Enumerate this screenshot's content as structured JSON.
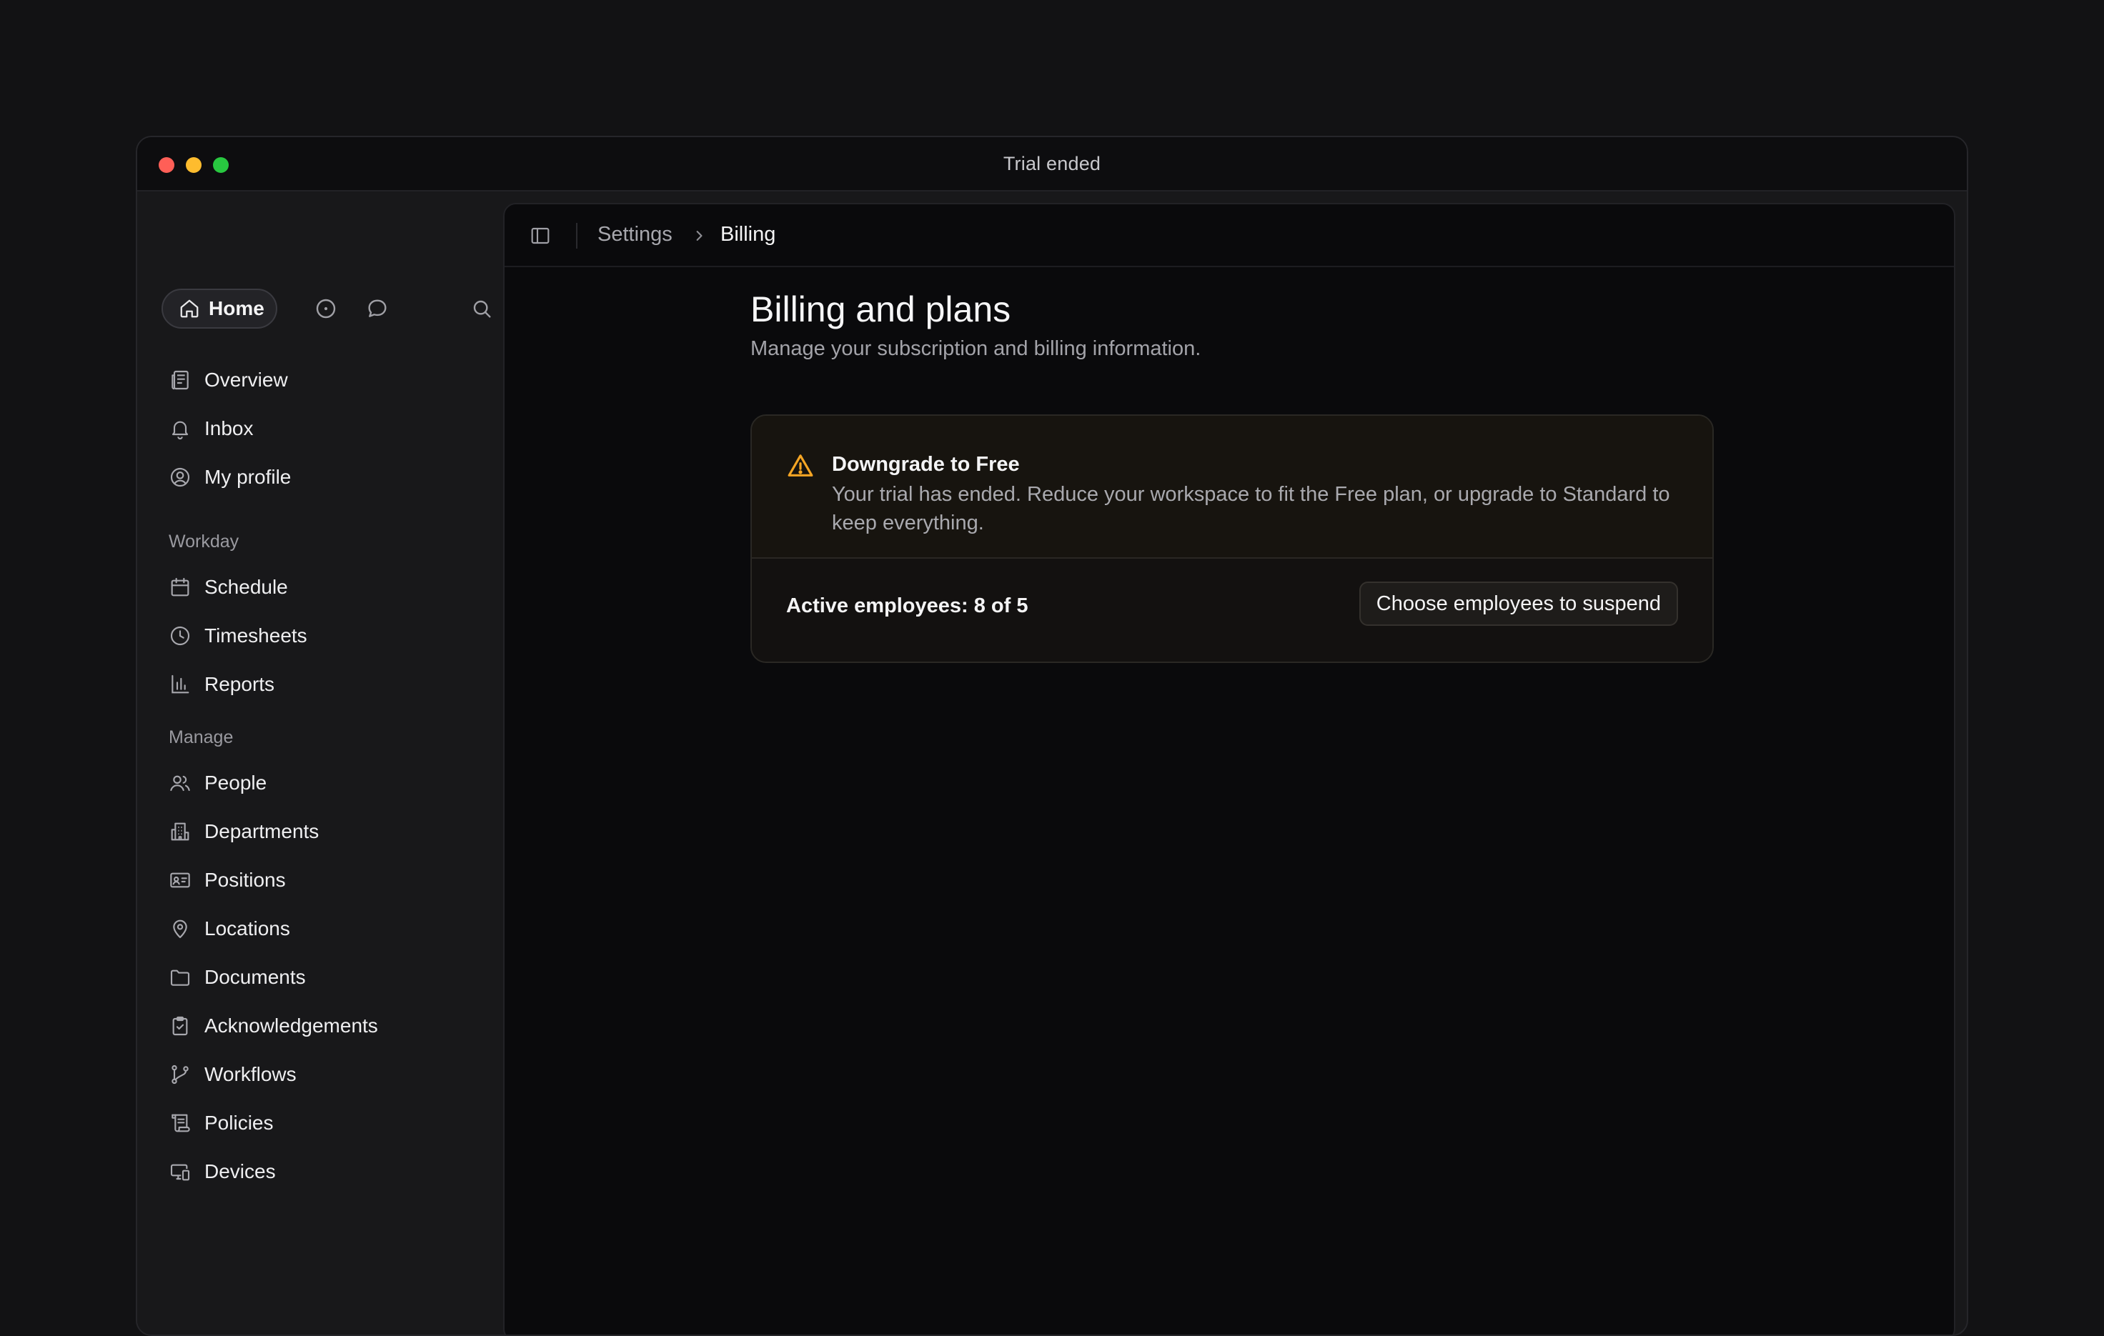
{
  "window": {
    "title": "Trial ended"
  },
  "quickbar": {
    "home_label": "Home"
  },
  "sidebar": {
    "primary": [
      {
        "label": "Overview",
        "icon": "overview-icon"
      },
      {
        "label": "Inbox",
        "icon": "bell-icon"
      },
      {
        "label": "My profile",
        "icon": "user-circle-icon"
      }
    ],
    "workday_label": "Workday",
    "workday": [
      {
        "label": "Schedule",
        "icon": "calendar-icon"
      },
      {
        "label": "Timesheets",
        "icon": "clock-icon"
      },
      {
        "label": "Reports",
        "icon": "bar-chart-icon"
      }
    ],
    "manage_label": "Manage",
    "manage": [
      {
        "label": "People",
        "icon": "people-icon"
      },
      {
        "label": "Departments",
        "icon": "building-icon"
      },
      {
        "label": "Positions",
        "icon": "id-card-icon"
      },
      {
        "label": "Locations",
        "icon": "map-pin-icon"
      },
      {
        "label": "Documents",
        "icon": "folder-icon"
      },
      {
        "label": "Acknowledgements",
        "icon": "clipboard-check-icon"
      },
      {
        "label": "Workflows",
        "icon": "git-branch-icon"
      },
      {
        "label": "Policies",
        "icon": "scroll-icon"
      },
      {
        "label": "Devices",
        "icon": "devices-icon"
      }
    ]
  },
  "breadcrumb": {
    "parent": "Settings",
    "current": "Billing"
  },
  "page": {
    "title": "Billing and plans",
    "subtitle": "Manage your subscription and billing information."
  },
  "alert": {
    "title": "Downgrade to Free",
    "body": "Your trial has ended. Reduce your workspace to fit the Free plan, or upgrade to Standard to keep everything.",
    "active_employees": "Active employees: 8 of 5",
    "action_label": "Choose employees to suspend",
    "accent_color": "#f5a524"
  }
}
